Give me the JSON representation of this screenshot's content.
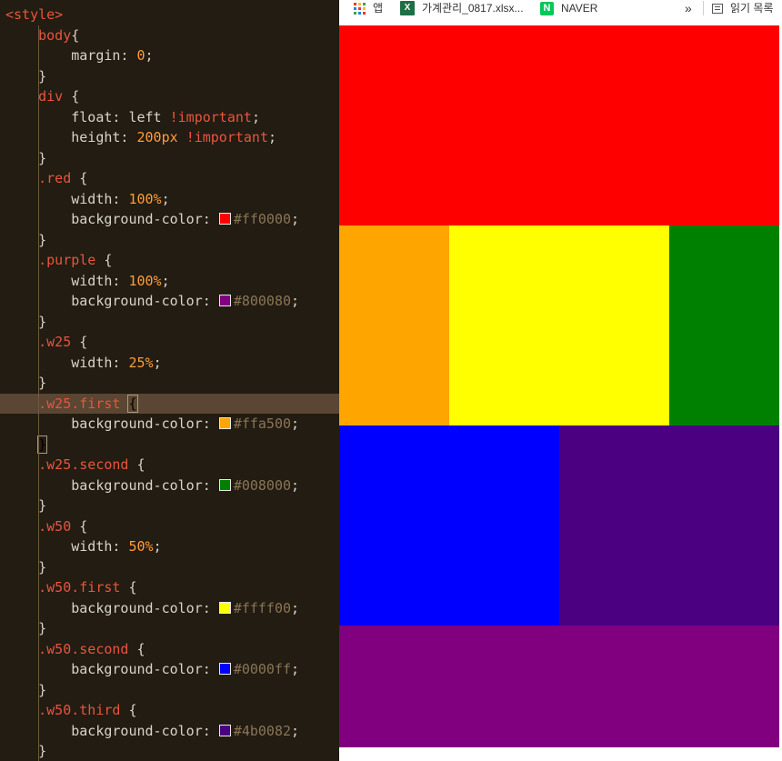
{
  "editor": {
    "lines": [
      [
        [
          "<style>",
          "sel"
        ]
      ],
      [
        [
          "    ",
          ""
        ],
        [
          "body",
          "sel"
        ],
        [
          "{",
          "br"
        ]
      ],
      [
        [
          "        ",
          ""
        ],
        [
          "margin: ",
          "prop"
        ],
        [
          "0",
          "num"
        ],
        [
          ";",
          "prop"
        ]
      ],
      [
        [
          "    ",
          ""
        ],
        [
          "}",
          "br"
        ]
      ],
      [
        [
          "    ",
          ""
        ],
        [
          "div",
          "sel"
        ],
        [
          " {",
          "br"
        ]
      ],
      [
        [
          "        ",
          ""
        ],
        [
          "float: left ",
          "prop"
        ],
        [
          "!important",
          "imp"
        ],
        [
          ";",
          "prop"
        ]
      ],
      [
        [
          "        ",
          ""
        ],
        [
          "height: ",
          "prop"
        ],
        [
          "200px",
          "num"
        ],
        [
          " ",
          "prop"
        ],
        [
          "!important",
          "imp"
        ],
        [
          ";",
          "prop"
        ]
      ],
      [
        [
          "    ",
          ""
        ],
        [
          "}",
          "br"
        ]
      ],
      [
        [
          "    ",
          ""
        ],
        [
          ".red",
          "sel"
        ],
        [
          " {",
          "br"
        ]
      ],
      [
        [
          "        ",
          ""
        ],
        [
          "width: ",
          "prop"
        ],
        [
          "100%",
          "num"
        ],
        [
          ";",
          "prop"
        ]
      ],
      [
        [
          "        ",
          ""
        ],
        [
          "background-color: ",
          "prop"
        ],
        [
          "",
          "swatch:#ff0000"
        ],
        [
          "#ff0000",
          "hex"
        ],
        [
          ";",
          "prop"
        ]
      ],
      [
        [
          "    ",
          ""
        ],
        [
          "}",
          "br"
        ]
      ],
      [
        [
          "    ",
          ""
        ],
        [
          ".purple",
          "sel"
        ],
        [
          " {",
          "br"
        ]
      ],
      [
        [
          "        ",
          ""
        ],
        [
          "width: ",
          "prop"
        ],
        [
          "100%",
          "num"
        ],
        [
          ";",
          "prop"
        ]
      ],
      [
        [
          "        ",
          ""
        ],
        [
          "background-color: ",
          "prop"
        ],
        [
          "",
          "swatch:#800080"
        ],
        [
          "#800080",
          "hex"
        ],
        [
          ";",
          "prop"
        ]
      ],
      [
        [
          "    ",
          ""
        ],
        [
          "}",
          "br"
        ]
      ],
      [
        [
          "    ",
          ""
        ],
        [
          ".w25",
          "sel"
        ],
        [
          " {",
          "br"
        ]
      ],
      [
        [
          "        ",
          ""
        ],
        [
          "width: ",
          "prop"
        ],
        [
          "25%",
          "num"
        ],
        [
          ";",
          "prop"
        ]
      ],
      [
        [
          "    ",
          ""
        ],
        [
          "}",
          "br"
        ]
      ],
      [
        [
          "    ",
          ""
        ],
        [
          ".w25.first",
          "sel"
        ],
        [
          " ",
          "br"
        ],
        [
          "{",
          "mbr"
        ]
      ],
      [
        [
          "        ",
          ""
        ],
        [
          "background-color: ",
          "prop"
        ],
        [
          "",
          "swatch:#ffa500"
        ],
        [
          "#ffa500",
          "hex"
        ],
        [
          ";",
          "prop"
        ]
      ],
      [
        [
          "    ",
          ""
        ],
        [
          "}",
          "mbr"
        ]
      ],
      [
        [
          "    ",
          ""
        ],
        [
          ".w25.second",
          "sel"
        ],
        [
          " {",
          "br"
        ]
      ],
      [
        [
          "        ",
          ""
        ],
        [
          "background-color: ",
          "prop"
        ],
        [
          "",
          "swatch:#008000"
        ],
        [
          "#008000",
          "hex"
        ],
        [
          ";",
          "prop"
        ]
      ],
      [
        [
          "    ",
          ""
        ],
        [
          "}",
          "br"
        ]
      ],
      [
        [
          "    ",
          ""
        ],
        [
          ".w50",
          "sel"
        ],
        [
          " {",
          "br"
        ]
      ],
      [
        [
          "        ",
          ""
        ],
        [
          "width: ",
          "prop"
        ],
        [
          "50%",
          "num"
        ],
        [
          ";",
          "prop"
        ]
      ],
      [
        [
          "    ",
          ""
        ],
        [
          "}",
          "br"
        ]
      ],
      [
        [
          "    ",
          ""
        ],
        [
          ".w50.first",
          "sel"
        ],
        [
          " {",
          "br"
        ]
      ],
      [
        [
          "        ",
          ""
        ],
        [
          "background-color: ",
          "prop"
        ],
        [
          "",
          "swatch:#ffff00"
        ],
        [
          "#ffff00",
          "hex"
        ],
        [
          ";",
          "prop"
        ]
      ],
      [
        [
          "    ",
          ""
        ],
        [
          "}",
          "br"
        ]
      ],
      [
        [
          "    ",
          ""
        ],
        [
          ".w50.second",
          "sel"
        ],
        [
          " {",
          "br"
        ]
      ],
      [
        [
          "        ",
          ""
        ],
        [
          "background-color: ",
          "prop"
        ],
        [
          "",
          "swatch:#0000ff"
        ],
        [
          "#0000ff",
          "hex"
        ],
        [
          ";",
          "prop"
        ]
      ],
      [
        [
          "    ",
          ""
        ],
        [
          "}",
          "br"
        ]
      ],
      [
        [
          "    ",
          ""
        ],
        [
          ".w50.third",
          "sel"
        ],
        [
          " {",
          "br"
        ]
      ],
      [
        [
          "        ",
          ""
        ],
        [
          "background-color: ",
          "prop"
        ],
        [
          "",
          "swatch:#4b0082"
        ],
        [
          "#4b0082",
          "hex"
        ],
        [
          ";",
          "prop"
        ]
      ],
      [
        [
          "    ",
          ""
        ],
        [
          "}",
          "br"
        ]
      ]
    ],
    "highlighted_line": 19
  },
  "bookmarks": {
    "apps_label": "앱",
    "excel_label": "가계관리_0817.xlsx...",
    "excel_badge": "X",
    "naver_label": "NAVER",
    "naver_badge": "N",
    "more_label": "»",
    "reading_list_label": "읽기 목록"
  },
  "page_blocks": [
    {
      "name": "red-block",
      "color": "#ff0000",
      "width_pct": 100
    },
    {
      "name": "orange-block",
      "color": "#ffa500",
      "width_pct": 25
    },
    {
      "name": "yellow-block",
      "color": "#ffff00",
      "width_pct": 50
    },
    {
      "name": "green-block",
      "color": "#008000",
      "width_pct": 25
    },
    {
      "name": "blue-block",
      "color": "#0000ff",
      "width_pct": 50
    },
    {
      "name": "indigo-block",
      "color": "#4b0082",
      "width_pct": 50
    },
    {
      "name": "purple-block",
      "color": "#800080",
      "width_pct": 100
    }
  ]
}
